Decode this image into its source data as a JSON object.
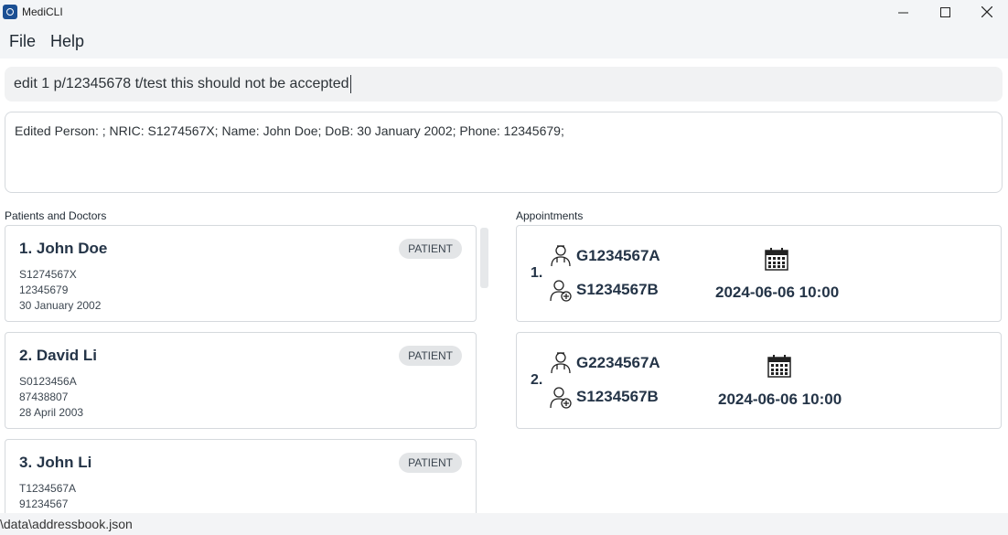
{
  "window": {
    "title": "MediCLI",
    "controls": {
      "minimize": "—",
      "maximize": "☐",
      "close": "✕"
    }
  },
  "menu": {
    "file": "File",
    "help": "Help"
  },
  "command": {
    "value": "edit 1 p/12345678 t/test this should not be accepted"
  },
  "result": {
    "text": "Edited Person: ; NRIC: S1274567X; Name: John Doe; DoB: 30 January 2002; Phone: 12345679;"
  },
  "persons": {
    "header": "Patients and Doctors",
    "items": [
      {
        "title": "1.  John Doe",
        "tag": "PATIENT",
        "nric": "S1274567X",
        "phone": "12345679",
        "dob": "30 January 2002"
      },
      {
        "title": "2.  David Li",
        "tag": "PATIENT",
        "nric": "S0123456A",
        "phone": "87438807",
        "dob": "28 April 2003"
      },
      {
        "title": "3.  John Li",
        "tag": "PATIENT",
        "nric": "T1234567A",
        "phone": "91234567",
        "dob": ""
      }
    ]
  },
  "appointments": {
    "header": "Appointments",
    "items": [
      {
        "index": "1.",
        "doctor": "G1234567A",
        "patient": "S1234567B",
        "datetime": "2024-06-06 10:00"
      },
      {
        "index": "2.",
        "doctor": "G2234567A",
        "patient": "S1234567B",
        "datetime": "2024-06-06 10:00"
      }
    ]
  },
  "icons": {
    "doctor": "doctor-icon",
    "patient": "patient-icon",
    "calendar": "calendar-icon"
  },
  "colors": {
    "accent": "#243447",
    "app_icon": "#1b4f93"
  },
  "status": {
    "path": "\\data\\addressbook.json"
  }
}
